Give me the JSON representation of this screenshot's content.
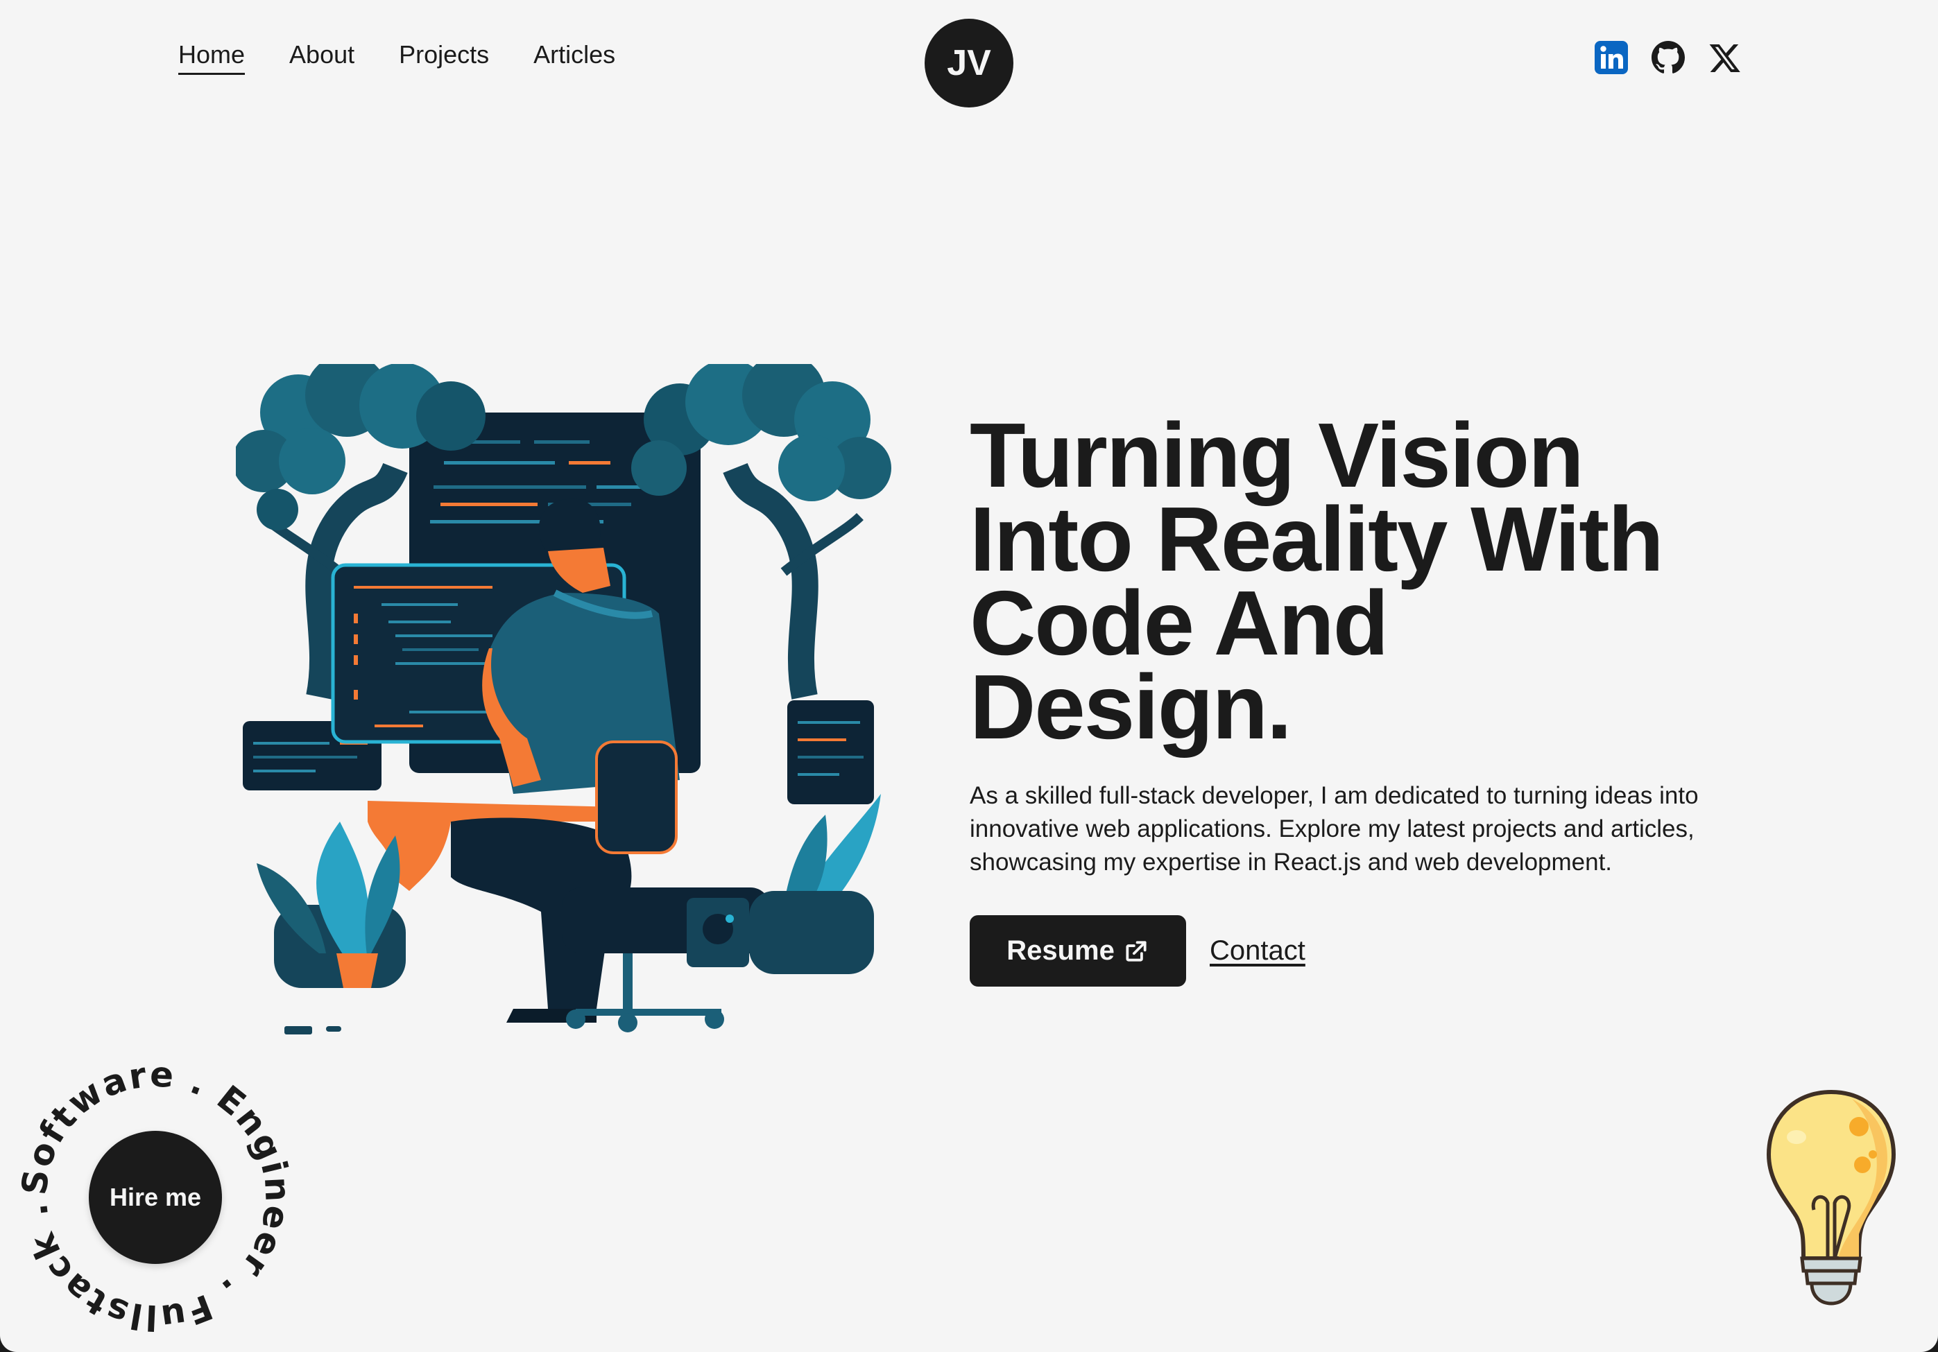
{
  "nav": {
    "links": [
      {
        "label": "Home",
        "active": true
      },
      {
        "label": "About",
        "active": false
      },
      {
        "label": "Projects",
        "active": false
      },
      {
        "label": "Articles",
        "active": false
      }
    ],
    "logo_text": "JV",
    "socials": [
      {
        "name": "LinkedIn",
        "icon": "linkedin-icon",
        "color": "#0a66c2"
      },
      {
        "name": "GitHub",
        "icon": "github-icon",
        "color": "#1b1b1b"
      },
      {
        "name": "X",
        "icon": "x-icon",
        "color": "#1b1b1b"
      }
    ]
  },
  "hero": {
    "headline_lines": [
      "Turning Vision",
      "Into Reality With",
      "Code And",
      "Design."
    ],
    "intro": "As a skilled full-stack developer, I am dedicated to turning ideas into innovative web applications. Explore my latest projects and articles, showcasing my expertise in React.js and web development.",
    "resume_label": "Resume",
    "contact_label": "Contact",
    "illustration_alt": "Developer coding at a desk among trees"
  },
  "hire": {
    "label": "Hire me",
    "ring_text": "Software . Engineer . Fullstack ."
  },
  "colors": {
    "background": "#f5f5f5",
    "dark": "#1b1b1b",
    "linkedin": "#0a66c2",
    "illustration_teal": "#1b5f78",
    "illustration_navy": "#0d2436",
    "illustration_orange": "#f47a35",
    "bulb_yellow": "#fbe387"
  }
}
